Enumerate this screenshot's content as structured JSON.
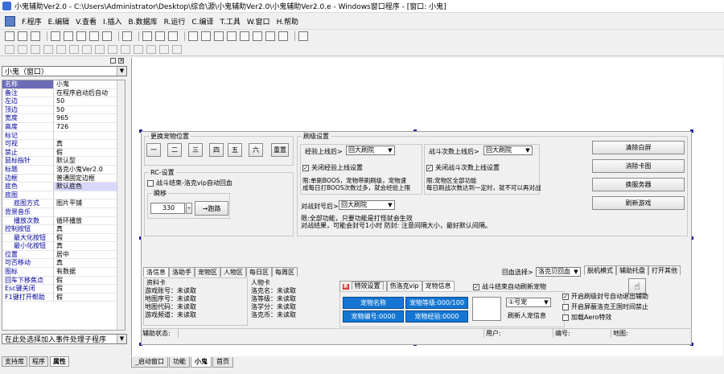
{
  "title": "小鬼辅助Ver2.0 - C:\\Users\\Administrator\\Desktop\\综合\\源\\小鬼辅助Ver2.0\\小鬼辅助Ver2.0.e - Windows窗口程序 - [窗口: 小鬼]",
  "menu": [
    "F.程序",
    "E.编辑",
    "V.查看",
    "I.插入",
    "B.数据库",
    "R.运行",
    "C.编译",
    "T.工具",
    "W.窗口",
    "H.帮助"
  ],
  "left_panel": {
    "object_combo": "小鬼（窗口）",
    "properties": [
      {
        "k": "名称",
        "v": "小鬼"
      },
      {
        "k": "备注",
        "v": "在程序启动后自动"
      },
      {
        "k": "左边",
        "v": "50"
      },
      {
        "k": "顶边",
        "v": "50"
      },
      {
        "k": "宽度",
        "v": "965"
      },
      {
        "k": "高度",
        "v": "726"
      },
      {
        "k": "标记",
        "v": ""
      },
      {
        "k": "可视",
        "v": "真"
      },
      {
        "k": "禁止",
        "v": "假"
      },
      {
        "k": "鼠标指针",
        "v": "默认型"
      },
      {
        "k": "标题",
        "v": "洛克小鬼Ver2.0"
      },
      {
        "k": "边框",
        "v": "普通固定边框"
      },
      {
        "k": "底色",
        "v": "默认底色"
      },
      {
        "k": "底图",
        "v": ""
      },
      {
        "k": "底图方式",
        "v": "图片平铺"
      },
      {
        "k": "背景音乐",
        "v": ""
      },
      {
        "k": "播放次数",
        "v": "循环播放"
      },
      {
        "k": "控制按钮",
        "v": "真"
      },
      {
        "k": "最大化按钮",
        "v": "假"
      },
      {
        "k": "最小化按钮",
        "v": "真"
      },
      {
        "k": "位置",
        "v": "居中"
      },
      {
        "k": "可否移动",
        "v": "真"
      },
      {
        "k": "图标",
        "v": "有数据"
      },
      {
        "k": "回车下移焦点",
        "v": "假"
      },
      {
        "k": "Esc键关闭",
        "v": "假"
      },
      {
        "k": "F1键打开帮助",
        "v": "假"
      }
    ],
    "event_combo": "在此处选择加入事件处理子程序",
    "tabs": [
      "支持库",
      "程序",
      "属性"
    ]
  },
  "form": {
    "pet_group": "更换宠物位置",
    "pet_buttons": [
      "一",
      "二",
      "三",
      "四",
      "五",
      "六",
      "重置"
    ],
    "rc_group": "RC-设置",
    "rc_check": "战斗结束-洛克vip自动回血",
    "move_group": "瞬移",
    "move_value": "330",
    "move_btn": "→跑路",
    "brush_group": "刷级设置",
    "exp_limit_label": "经验上线后>",
    "exp_limit_value": "回大刷院",
    "close_exp_check": "关闭经验上线设置",
    "exp_note1": "限:单刷BOOS，宠物带刷刷级，宠物速",
    "exp_note2": "成每日打BOOS次数过多，就会经验上限",
    "battle_limit_label": "战斗次数上线后>",
    "battle_limit_value": "回大刷院",
    "close_battle_check": "关闭战斗次数上线设置",
    "battle_note1": "限:宠物区全部功能",
    "battle_note2": "每日刷战次数达到一定时，就不可以再对战",
    "seal_label": "对战封号后>",
    "seal_value": "回大刷院",
    "seal_note1": "限:全部功能，只要功能是打怪就会生效",
    "seal_note2": "对战结果，可能会封号1小时 防封: 注意间隔大小，最好默认间隔。",
    "right_buttons": [
      "清除白屏",
      "消除卡图",
      "换服务器",
      "刷新游戏"
    ],
    "tabs_left": [
      "洛信息",
      "洛助手",
      "宠物区",
      "人物区",
      "每日区",
      "每周区"
    ],
    "return_label": "回血选择>",
    "return_value": "洛克贝回血",
    "tabs_right": [
      "脱机模式",
      "辅助托盘",
      "打开其他"
    ],
    "info_title": "资料卡",
    "info_rows": [
      "游戏账号：未读取",
      "地图序号：未读取",
      "地图代码：未读取",
      "游戏频道：未读取"
    ],
    "person_title": "人物卡",
    "person_rows": [
      "洛克名：未读取",
      "洛等级：未读取",
      "洛学分：未读取",
      "洛克币：未读取"
    ],
    "sub_tabs": [
      "特效设置",
      "伤洛克vip",
      "宠物信息"
    ],
    "auto_check": "战斗结束自动刷新宠物",
    "pet_name": "宠物名称",
    "pet_level": "宠物等级:000/100",
    "pet_id": "宠物编号:0000",
    "pet_exp": "宠物经验:0000",
    "pet_slot": "①号宠",
    "refresh_btn": "刷新人宠信息",
    "options": [
      "开启刷级封号自动退出辅助",
      "开启屏蔽洛克王国时间禁止",
      "加载Aero特效"
    ],
    "status": {
      "assist": "辅助状态:",
      "user": "用户:",
      "id": "编号:",
      "map": "地图:"
    }
  },
  "bottom_tabs": [
    "_启动窗口",
    "功能",
    "小鬼",
    "首页"
  ]
}
